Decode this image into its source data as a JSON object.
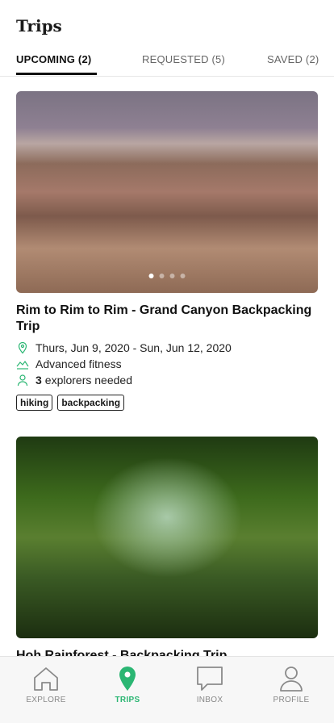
{
  "header": {
    "title": "Trips"
  },
  "tabs": [
    {
      "label": "UPCOMING (2)"
    },
    {
      "label": "REQUESTED (5)"
    },
    {
      "label": "SAVED (2)"
    }
  ],
  "trips": [
    {
      "title": "Rim to Rim to Rim - Grand Canyon Backpacking Trip",
      "dates": "Thurs, Jun 9, 2020 - Sun, Jun 12, 2020",
      "fitness": "Advanced fitness",
      "explorers_count": "3",
      "explorers_text": "explorers needed",
      "tags": [
        "hiking",
        "backpacking"
      ],
      "carousel_pages": 4,
      "carousel_active": 1
    },
    {
      "title": "Hoh Rainforest - Backpacking Trip"
    }
  ],
  "nav": {
    "items": [
      {
        "label": "EXPLORE",
        "icon": "home-icon"
      },
      {
        "label": "TRIPS",
        "icon": "location-pin-icon"
      },
      {
        "label": "INBOX",
        "icon": "chat-icon"
      },
      {
        "label": "PROFILE",
        "icon": "user-icon"
      }
    ],
    "active_color": "#2bb673"
  }
}
